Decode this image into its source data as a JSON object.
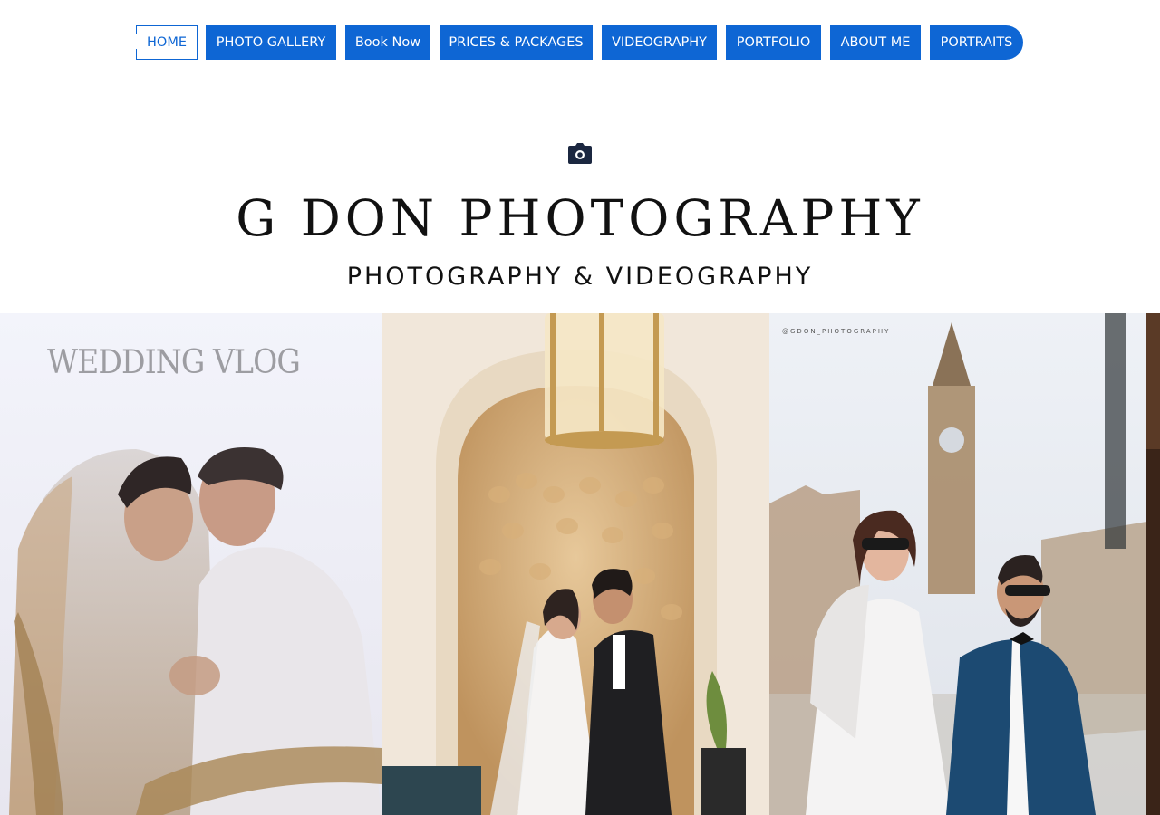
{
  "nav": {
    "items": [
      {
        "label": "HOME",
        "active": true
      },
      {
        "label": "PHOTO GALLERY"
      },
      {
        "label": "Book Now"
      },
      {
        "label": "PRICES & PACKAGES"
      },
      {
        "label": "VIDEOGRAPHY"
      },
      {
        "label": "PORTFOLIO"
      },
      {
        "label": "ABOUT ME"
      },
      {
        "label": "PORTRAITS"
      }
    ],
    "accent": "#0e66d4"
  },
  "header": {
    "icon": "camera-icon",
    "title": "G DON  PHOTOGRAPHY",
    "tagline": "PHOTOGRAPHY & VIDEOGRAPHY"
  },
  "gallery": {
    "tiles": [
      {
        "overlay_text": "WEDDING VLOG"
      },
      {
        "overlay_text": ""
      },
      {
        "overlay_text": "@GDON_PHOTOGRAPHY"
      },
      {
        "overlay_text": ""
      }
    ]
  }
}
